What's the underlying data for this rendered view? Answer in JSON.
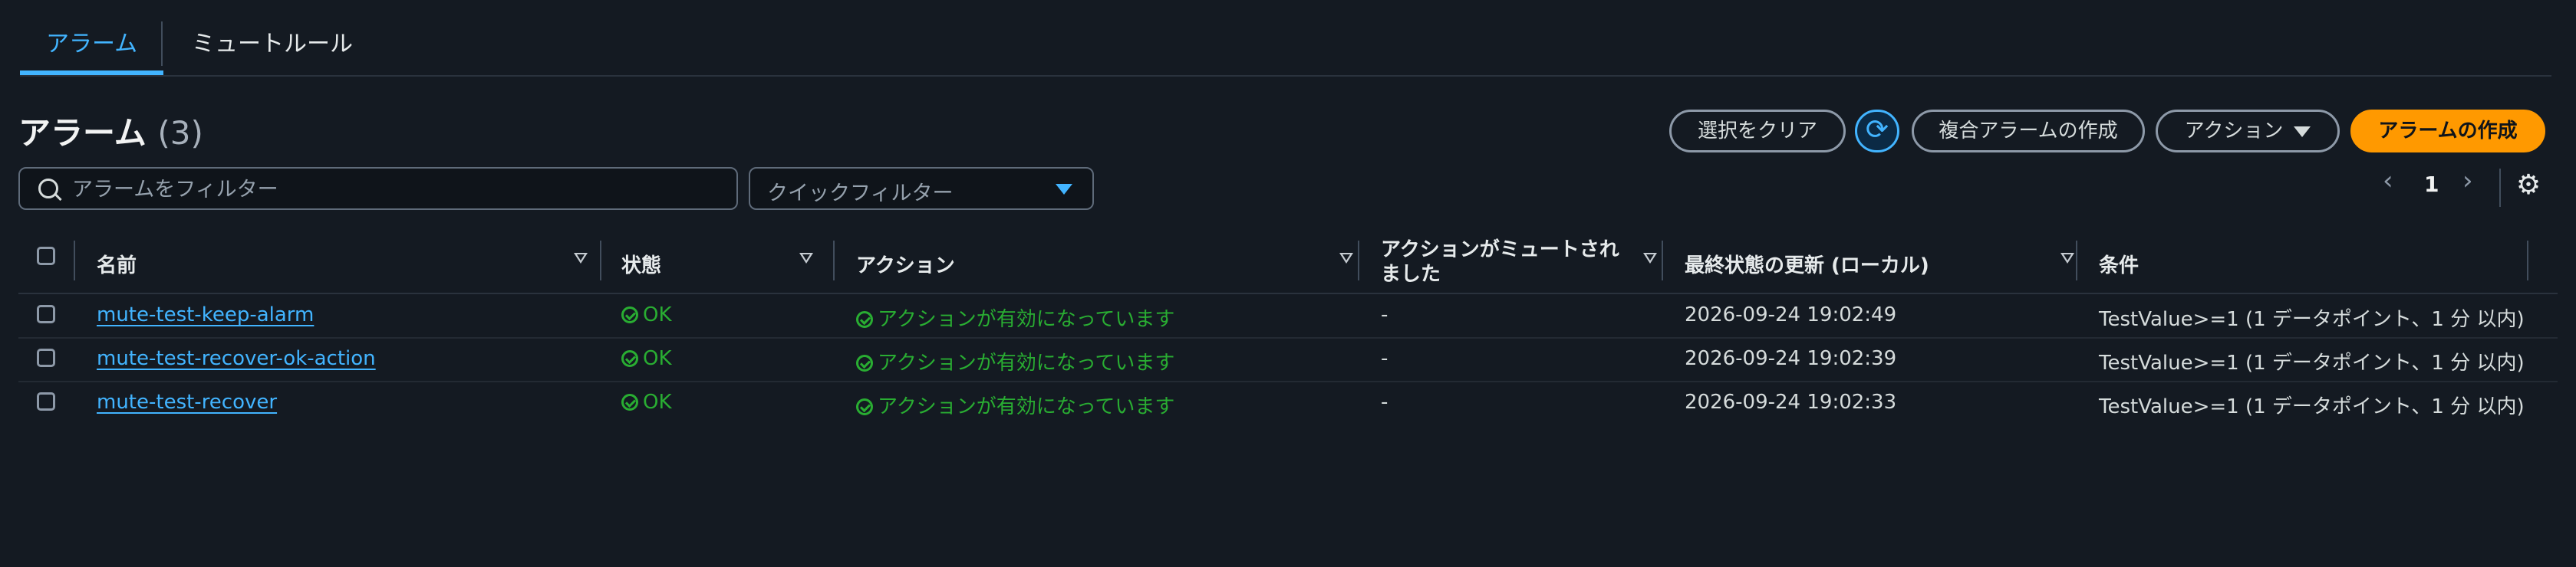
{
  "tabs": [
    {
      "label": "アラーム",
      "active": true
    },
    {
      "label": "ミュートルール",
      "active": false
    }
  ],
  "header": {
    "title": "アラーム",
    "count": "(3)",
    "clear_label": "選択をクリア",
    "composite_label": "複合アラームの作成",
    "action_label": "アクション",
    "create_label": "アラームの作成"
  },
  "filters": {
    "search_placeholder": "アラームをフィルター",
    "quick_filter_label": "クイックフィルター"
  },
  "pagination": {
    "page": "1"
  },
  "columns": {
    "name": "名前",
    "state": "状態",
    "actions": "アクション",
    "muted_line1": "アクションがミュートされ",
    "muted_line2": "ました",
    "last_update": "最終状態の更新 (ローカル)",
    "condition": "条件"
  },
  "rows": [
    {
      "name": "mute-test-keep-alarm",
      "state": "OK",
      "actions": "アクションが有効になっています",
      "muted": "-",
      "last_update": "2026-09-24 19:02:49",
      "condition": "TestValue>=1 (1 データポイント、1 分 以内)"
    },
    {
      "name": "mute-test-recover-ok-action",
      "state": "OK",
      "actions": "アクションが有効になっています",
      "muted": "-",
      "last_update": "2026-09-24 19:02:39",
      "condition": "TestValue>=1 (1 データポイント、1 分 以内)"
    },
    {
      "name": "mute-test-recover",
      "state": "OK",
      "actions": "アクションが有効になっています",
      "muted": "-",
      "last_update": "2026-09-24 19:02:33",
      "condition": "TestValue>=1 (1 データポイント、1 分 以内)"
    }
  ],
  "colors": {
    "accent": "#42b4ff",
    "primary_button": "#ff9900",
    "ok": "#29ad32",
    "background": "#141a22"
  },
  "icons": [
    "search-icon",
    "refresh-icon",
    "caret-down-icon",
    "chevron-left-icon",
    "chevron-right-icon",
    "gear-icon",
    "ok-status-icon"
  ]
}
